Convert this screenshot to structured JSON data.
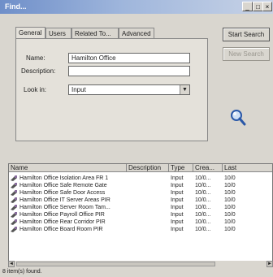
{
  "window": {
    "title": "Find...",
    "controls": [
      "_",
      "□",
      "×"
    ]
  },
  "tabs": [
    {
      "label": "General"
    },
    {
      "label": "Users"
    },
    {
      "label": "Related To..."
    },
    {
      "label": "Advanced"
    }
  ],
  "form": {
    "name_label": "Name:",
    "name_value": "Hamilton Office",
    "description_label": "Description:",
    "description_value": "",
    "look_in_label": "Look in:",
    "look_in_value": "Input"
  },
  "buttons": {
    "start_search": "Start Search",
    "new_search": "New Search"
  },
  "results": {
    "columns": [
      "Name",
      "Description",
      "Type",
      "Crea...",
      "Last"
    ],
    "rows": [
      {
        "name": "Hamilton Office Isolation Area FR 1",
        "description": "",
        "type": "Input",
        "created": "10/0...",
        "last": "10/0"
      },
      {
        "name": "Hamilton Office Safe Remote Gate",
        "description": "",
        "type": "Input",
        "created": "10/0...",
        "last": "10/0"
      },
      {
        "name": "Hamilton Office Safe Door Access",
        "description": "",
        "type": "Input",
        "created": "10/0...",
        "last": "10/0"
      },
      {
        "name": "Hamilton Office IT Server Areas PIR",
        "description": "",
        "type": "Input",
        "created": "10/0...",
        "last": "10/0"
      },
      {
        "name": "Hamilton Office Server Room Tam...",
        "description": "",
        "type": "Input",
        "created": "10/0...",
        "last": "10/0"
      },
      {
        "name": "Hamilton Office Payroll Office PIR",
        "description": "",
        "type": "Input",
        "created": "10/0...",
        "last": "10/0"
      },
      {
        "name": "Hamilton Office Rear Corridor PIR",
        "description": "",
        "type": "Input",
        "created": "10/0...",
        "last": "10/0"
      },
      {
        "name": "Hamilton Office Board Room PIR",
        "description": "",
        "type": "Input",
        "created": "10/0...",
        "last": "10/0"
      }
    ]
  },
  "status": "8 item(s) found."
}
